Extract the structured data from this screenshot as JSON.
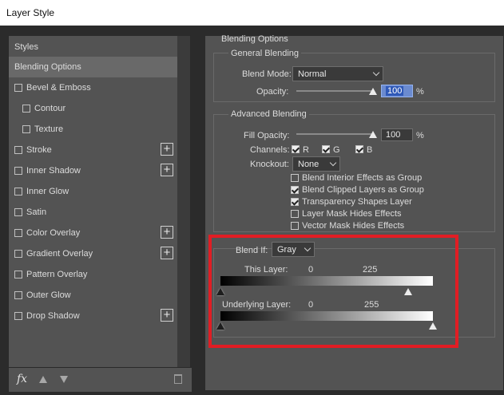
{
  "window": {
    "title": "Layer Style"
  },
  "colors": {
    "highlight": "#e11d24",
    "selected": "#696969",
    "accent_input": "#2f59b8"
  },
  "left_panel": {
    "styles_header": "Styles",
    "items": [
      {
        "label": "Blending Options",
        "checkbox": false,
        "add": false,
        "selected": true
      },
      {
        "label": "Bevel & Emboss",
        "checkbox": true,
        "add": false
      },
      {
        "label": "Contour",
        "checkbox": true,
        "add": false,
        "indent": true
      },
      {
        "label": "Texture",
        "checkbox": true,
        "add": false,
        "indent": true
      },
      {
        "label": "Stroke",
        "checkbox": true,
        "add": true
      },
      {
        "label": "Inner Shadow",
        "checkbox": true,
        "add": true
      },
      {
        "label": "Inner Glow",
        "checkbox": true,
        "add": false
      },
      {
        "label": "Satin",
        "checkbox": true,
        "add": false
      },
      {
        "label": "Color Overlay",
        "checkbox": true,
        "add": true
      },
      {
        "label": "Gradient Overlay",
        "checkbox": true,
        "add": true
      },
      {
        "label": "Pattern Overlay",
        "checkbox": true,
        "add": false
      },
      {
        "label": "Outer Glow",
        "checkbox": true,
        "add": false
      },
      {
        "label": "Drop Shadow",
        "checkbox": true,
        "add": true
      }
    ],
    "footer": {
      "fx_label": "fx",
      "icons": [
        "move-up-icon",
        "move-down-icon",
        "trash-icon"
      ]
    }
  },
  "blending": {
    "section_title": "Blending Options",
    "general": {
      "title": "General Blending",
      "blend_mode_label": "Blend Mode:",
      "blend_mode_value": "Normal",
      "opacity_label": "Opacity:",
      "opacity_value": "100",
      "opacity_unit": "%",
      "opacity_level": 1.0
    },
    "advanced": {
      "title": "Advanced Blending",
      "fill_opacity_label": "Fill Opacity:",
      "fill_opacity_value": "100",
      "fill_opacity_unit": "%",
      "fill_opacity_level": 1.0,
      "channels_label": "Channels:",
      "channels": [
        {
          "label": "R",
          "checked": true
        },
        {
          "label": "G",
          "checked": true
        },
        {
          "label": "B",
          "checked": true
        }
      ],
      "knockout_label": "Knockout:",
      "knockout_value": "None",
      "options": [
        {
          "label": "Blend Interior Effects as Group",
          "checked": false
        },
        {
          "label": "Blend Clipped Layers as Group",
          "checked": true
        },
        {
          "label": "Transparency Shapes Layer",
          "checked": true
        },
        {
          "label": "Layer Mask Hides Effects",
          "checked": false
        },
        {
          "label": "Vector Mask Hides Effects",
          "checked": false
        }
      ]
    },
    "blend_if": {
      "label": "Blend If:",
      "value": "Gray",
      "this_layer": {
        "label": "This Layer:",
        "low": "0",
        "high": "225",
        "low_level": 0,
        "high_level": 225
      },
      "underlying_layer": {
        "label": "Underlying Layer:",
        "low": "0",
        "high": "255",
        "low_level": 0,
        "high_level": 255
      }
    }
  }
}
